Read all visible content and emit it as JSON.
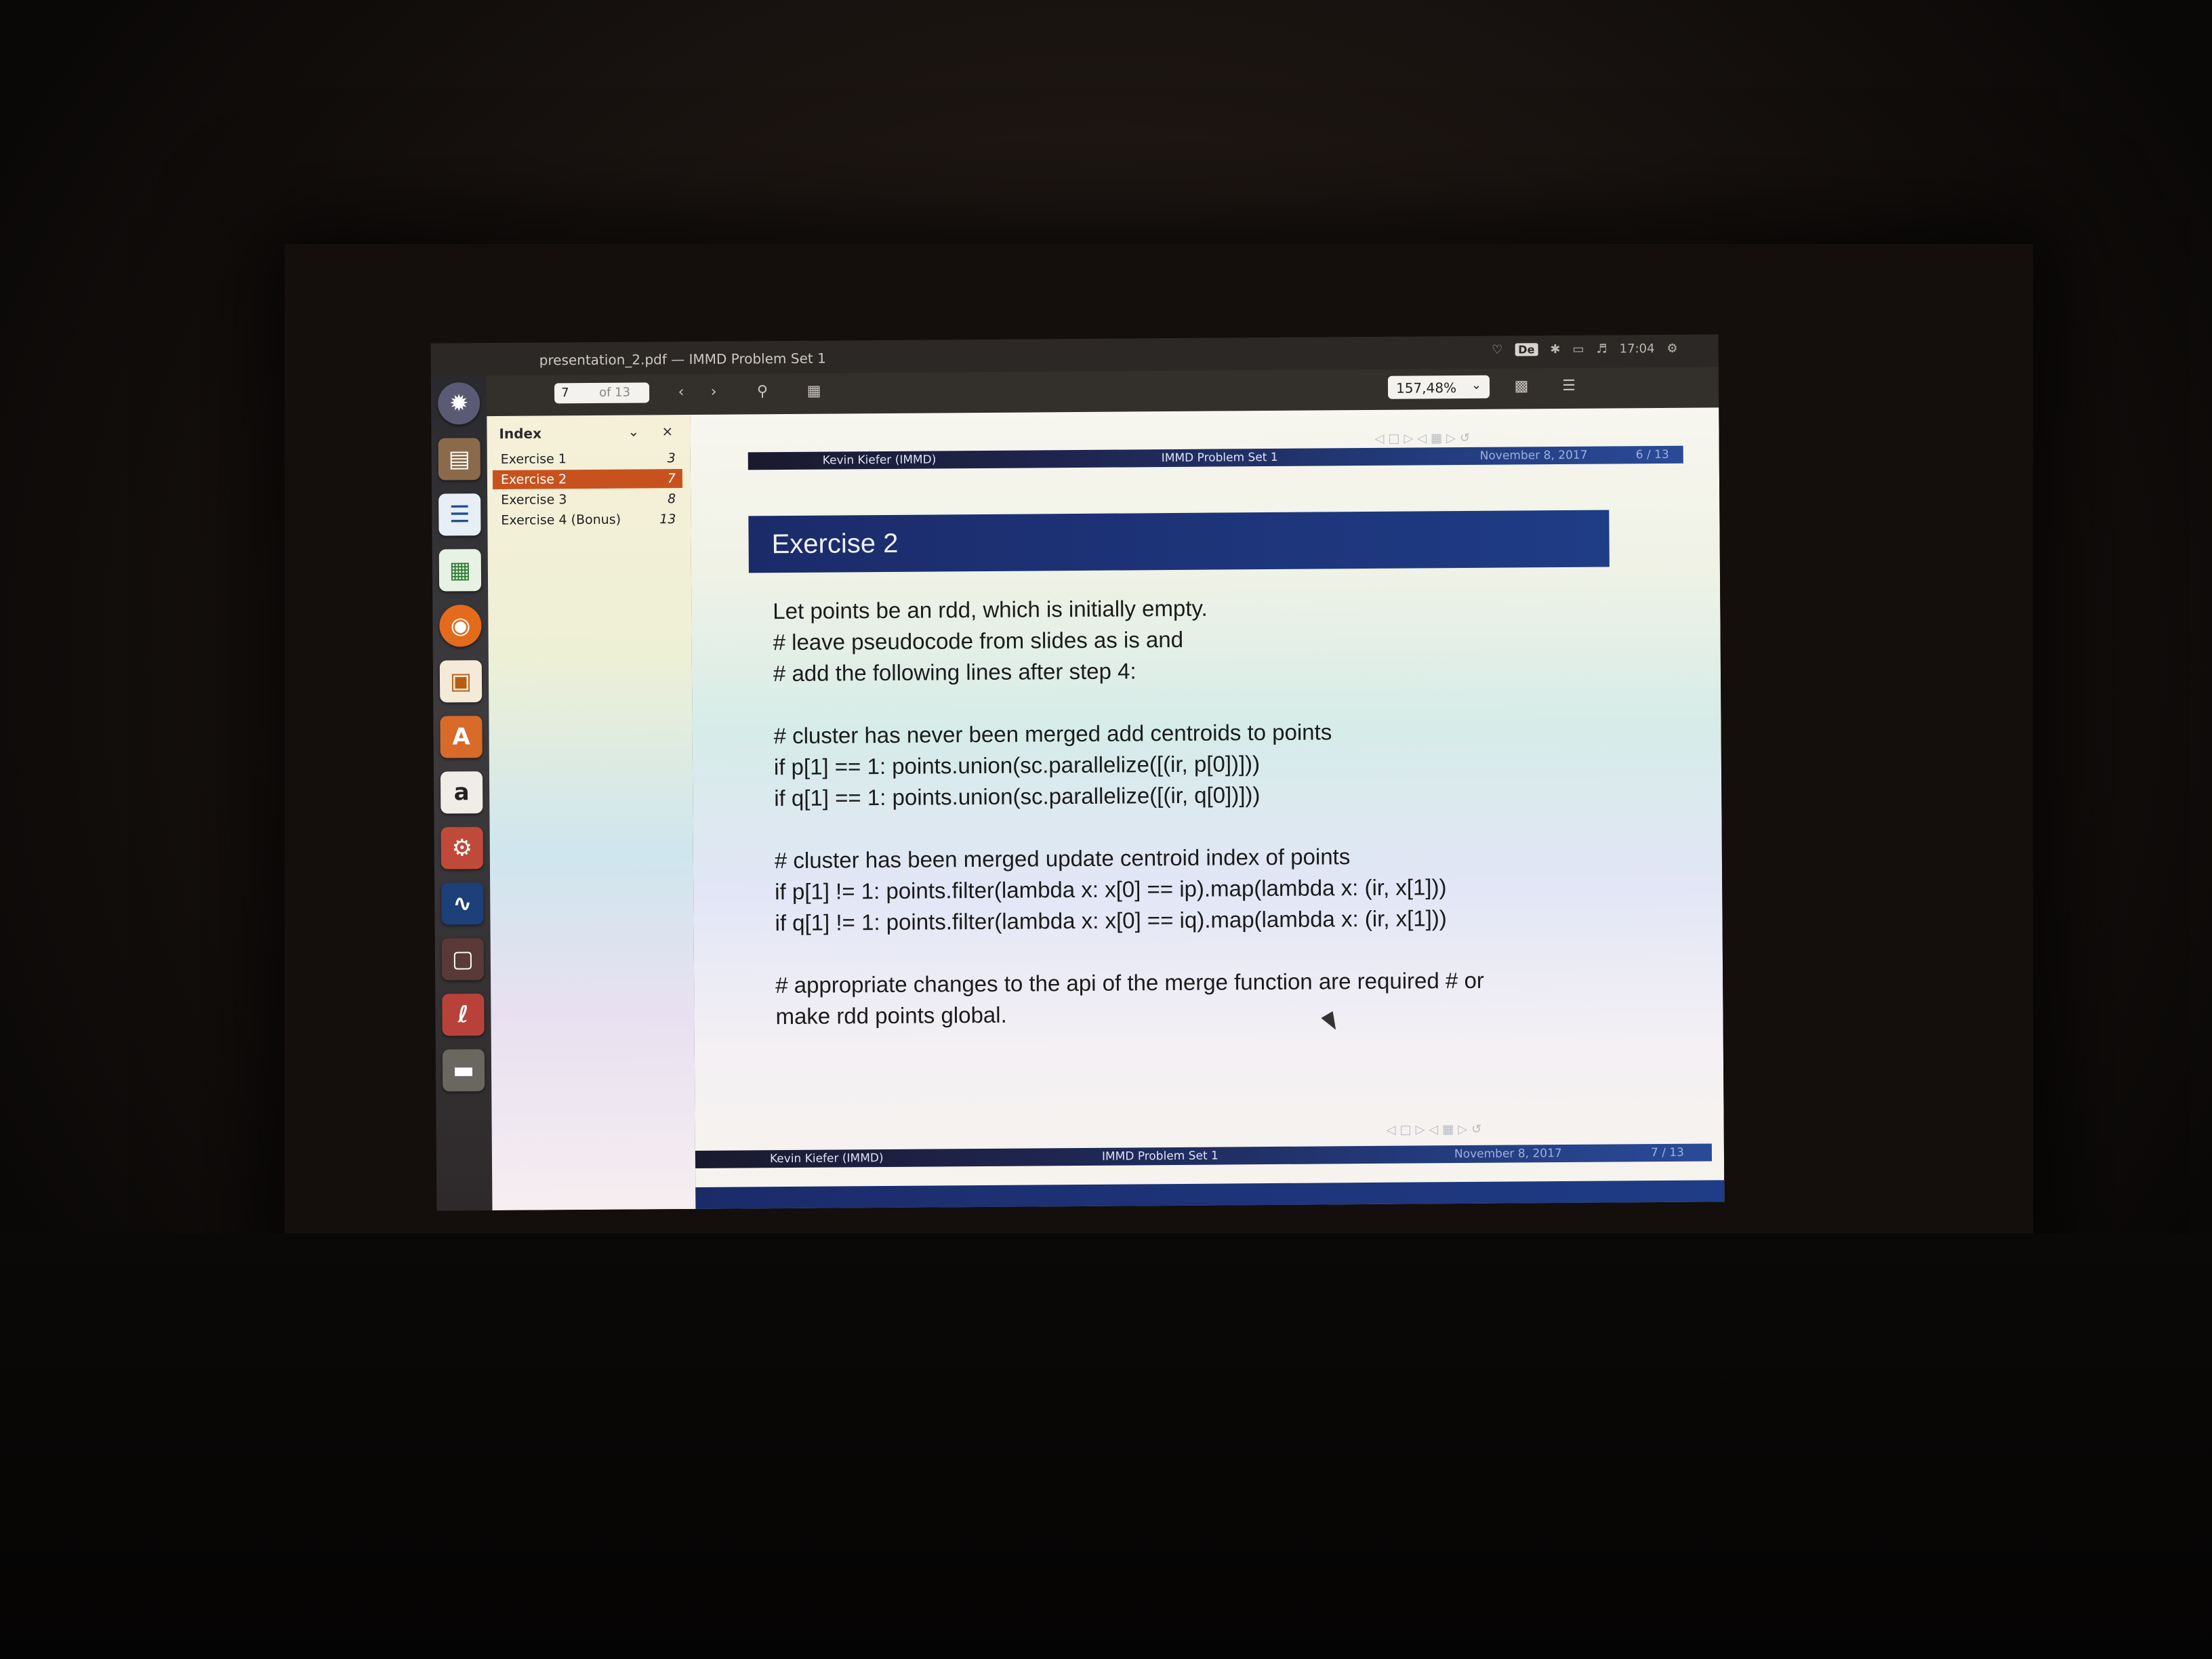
{
  "window": {
    "title": "presentation_2.pdf — IMMD Problem Set 1"
  },
  "indicators": {
    "keyboard": "De",
    "clock": "17:04"
  },
  "toolbar": {
    "page_current": "7",
    "page_total": "of 13",
    "zoom": "157,48%",
    "icons": [
      "chevron-left-icon",
      "chevron-right-icon",
      "search-icon",
      "annotation-icon",
      "save-icon",
      "menu-icon"
    ]
  },
  "sidebar": {
    "title": "Index",
    "items": [
      {
        "label": "Exercise 1",
        "page": "3"
      },
      {
        "label": "Exercise 2",
        "page": "7"
      },
      {
        "label": "Exercise 3",
        "page": "8"
      },
      {
        "label": "Exercise 4 (Bonus)",
        "page": "13"
      }
    ],
    "selected_index": 1
  },
  "previous_slide_footer": {
    "author": "Kevin Kiefer (IMMD)",
    "title": "IMMD Problem Set 1",
    "date": "November 8, 2017",
    "page": "6 / 13"
  },
  "slide": {
    "title": "Exercise 2",
    "lines": [
      "Let points be an rdd, which is initially empty.",
      "# leave pseudocode from slides as is and",
      "# add the following lines after step 4:",
      "",
      "# cluster has never been merged add centroids to points",
      "if p[1] == 1: points.union(sc.parallelize([(ir, p[0])]))",
      "if q[1] == 1: points.union(sc.parallelize([(ir, q[0])]))",
      "",
      "# cluster has been merged update centroid index of points",
      "if p[1] != 1: points.filter(lambda x: x[0] == ip).map(lambda x: (ir, x[1]))",
      "if q[1] != 1: points.filter(lambda x: x[0] == iq).map(lambda x: (ir, x[1]))",
      "",
      "# appropriate changes to the api of the merge function are required # or",
      "make rdd points global."
    ]
  },
  "slide_footer": {
    "author": "Kevin Kiefer (IMMD)",
    "title": "IMMD Problem Set 1",
    "date": "November 8, 2017",
    "page": "7 / 13"
  },
  "launcher": {
    "icons": [
      "ubuntu-dash-icon",
      "files-icon",
      "writer-icon",
      "calc-icon",
      "firefox-icon",
      "impress-icon",
      "software-center-icon",
      "amazon-icon",
      "settings-icon",
      "system-monitor-icon",
      "screenshot-icon",
      "document-viewer-icon",
      "trash-icon"
    ]
  }
}
